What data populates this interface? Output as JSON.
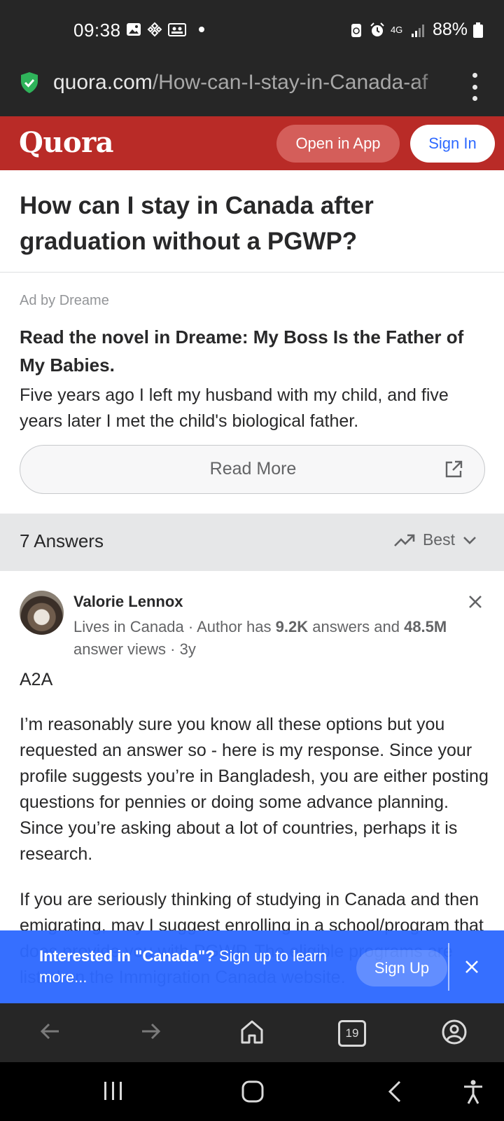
{
  "status_bar": {
    "time": "09:38",
    "network": "4G",
    "battery": "88%"
  },
  "url_bar": {
    "domain": "quora.com",
    "path": "/How-can-I-stay-in-Canada-af"
  },
  "header": {
    "logo": "Quora",
    "open_in_app": "Open in App",
    "sign_in": "Sign In",
    "brand_color": "#b92b27"
  },
  "question": {
    "title": "How can I stay in Canada after graduation without a PGWP?"
  },
  "ad": {
    "label": "Ad by Dreame",
    "title": "Read the novel in Dreame: My Boss Is the Father of My Babies.",
    "body": "Five years ago I left my husband with my child, and five years later I met the child's biological father.",
    "button": "Read More"
  },
  "answers_bar": {
    "count_label": "7 Answers",
    "sort_label": "Best"
  },
  "answer": {
    "author": "Valorie Lennox",
    "meta_prefix": "Lives in Canada · Author has ",
    "answers_count": "9.2K",
    "meta_middle": " answers and ",
    "views_count": "48.5M",
    "meta_suffix": " answer views · 3y",
    "a2a": "A2A",
    "paragraph1": "I’m reasonably sure you know all these options but you requested an answer so - here is my response. Since your profile suggests you’re in Bangladesh, you are either posting questions for pennies or doing some advance planning. Since you’re asking about a lot of countries, perhaps it is research.",
    "paragraph2": "If you are seriously thinking of studying in Canada and then emigrating, may I suggest enrolling in a school/program that does provide you with PGWP. The eligible programs are listed on the Immigration Canada website."
  },
  "banner": {
    "strong": "Interested in \"Canada\"?",
    "rest": " Sign up to learn more...",
    "signup": "Sign Up",
    "color": "#2e69ff"
  },
  "browser_bar": {
    "tab_count": "19"
  }
}
